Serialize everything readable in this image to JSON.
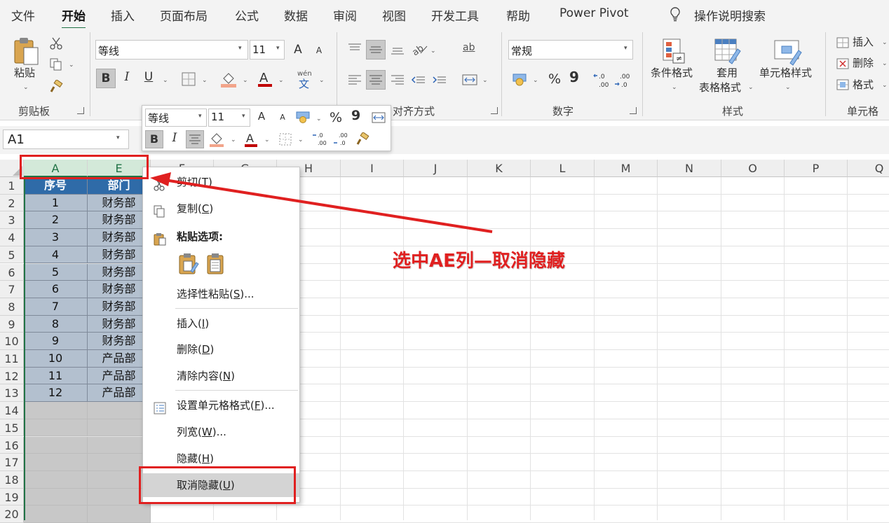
{
  "tabs": [
    "文件",
    "开始",
    "插入",
    "页面布局",
    "公式",
    "数据",
    "审阅",
    "视图",
    "开发工具",
    "帮助",
    "Power Pivot"
  ],
  "active_tab": "开始",
  "tell_me": "操作说明搜索",
  "ribbon": {
    "clipboard": {
      "paste_label": "粘贴",
      "group_label": "剪贴板"
    },
    "font": {
      "font_name": "等线",
      "font_size": "11",
      "bold": "B",
      "italic": "I",
      "underline": "U",
      "phonetic_top": "wén",
      "phonetic_bottom": "文",
      "grow": "A",
      "shrink": "A"
    },
    "alignment": {
      "group_label": "对齐方式",
      "wrap_glyph": "ab"
    },
    "number": {
      "format": "常规",
      "group_label": "数字",
      "percent": "%",
      "comma": "9",
      "inc_dec": ".0\n.00",
      "dec_dec": ".00\n.0"
    },
    "styles": {
      "cond_format": "条件格式",
      "table_format_1": "套用",
      "table_format_2": "表格格式",
      "cell_styles": "单元格样式",
      "group_label": "样式"
    },
    "cells": {
      "insert": "插入",
      "delete": "删除",
      "format": "格式",
      "group_label": "单元格"
    }
  },
  "name_box": "A1",
  "mini_toolbar": {
    "font_name": "等线",
    "font_size": "11",
    "bold": "B",
    "italic": "I",
    "percent": "%",
    "comma": "9"
  },
  "columns": [
    "A",
    "E",
    "F",
    "G",
    "H",
    "I",
    "J",
    "K",
    "L",
    "M",
    "N",
    "O",
    "P",
    "Q"
  ],
  "rows": [
    "1",
    "2",
    "3",
    "4",
    "5",
    "6",
    "7",
    "8",
    "9",
    "10",
    "11",
    "12",
    "13",
    "14",
    "15",
    "16",
    "17",
    "18",
    "19",
    "20"
  ],
  "table": {
    "headers": [
      "序号",
      "部门"
    ],
    "rows": [
      [
        "1",
        "财务部"
      ],
      [
        "2",
        "财务部"
      ],
      [
        "3",
        "财务部"
      ],
      [
        "4",
        "财务部"
      ],
      [
        "5",
        "财务部"
      ],
      [
        "6",
        "财务部"
      ],
      [
        "7",
        "财务部"
      ],
      [
        "8",
        "财务部"
      ],
      [
        "9",
        "财务部"
      ],
      [
        "10",
        "产品部"
      ],
      [
        "11",
        "产品部"
      ],
      [
        "12",
        "产品部"
      ]
    ]
  },
  "context_menu": {
    "cut": "剪切",
    "cut_key": "T",
    "copy": "复制",
    "copy_key": "C",
    "paste_options": "粘贴选项:",
    "paste_special": "选择性粘贴",
    "paste_special_key": "S",
    "insert": "插入",
    "insert_key": "I",
    "delete": "删除",
    "delete_key": "D",
    "clear": "清除内容",
    "clear_key": "N",
    "format_cells": "设置单元格格式",
    "format_cells_key": "F",
    "col_width": "列宽",
    "col_width_key": "W",
    "hide": "隐藏",
    "hide_key": "H",
    "unhide": "取消隐藏",
    "unhide_key": "U"
  },
  "annotation": "选中AE列—取消隐藏",
  "colors": {
    "accent": "#217346",
    "annotation_red": "#e02020",
    "table_header": "#2f6ba8",
    "table_body": "#b3c0cf"
  }
}
